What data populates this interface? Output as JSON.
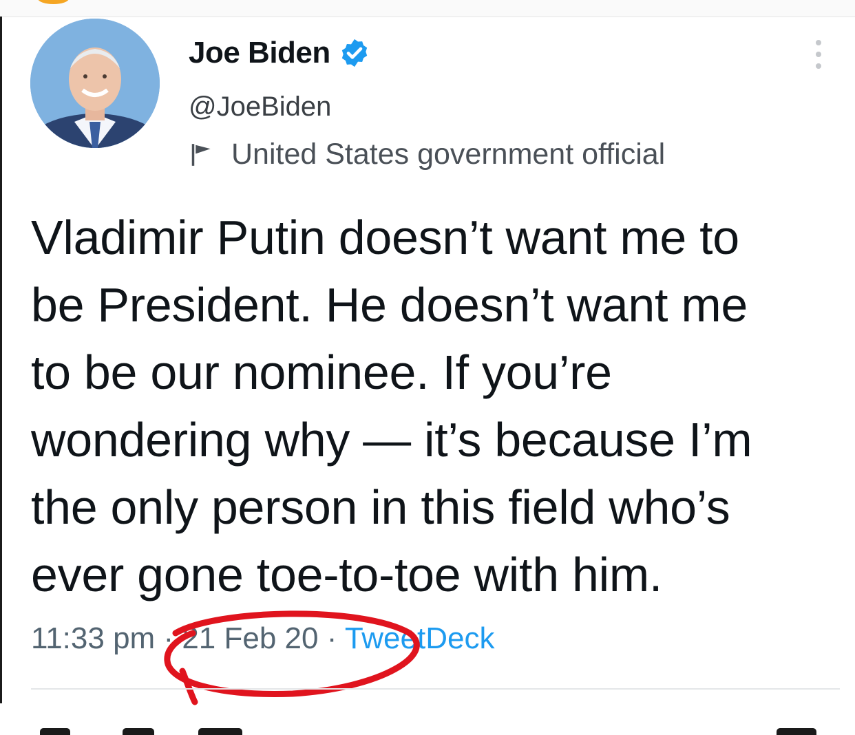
{
  "tweet": {
    "author_name": "Joe Biden",
    "handle": "@JoeBiden",
    "account_label": "United States government official",
    "text": "Vladimir Putin doesn’t want me to\nbe President. He doesn’t want me\nto be our nominee. If you’re\nwondering why — it’s because I’m\nthe only person in this field who’s\never gone toe-to-toe with him.",
    "time": "11:33 pm",
    "date": "21 Feb 20",
    "source": "TweetDeck",
    "separator": "·"
  },
  "icons": {
    "verified": "verified-badge-icon",
    "label_flag": "flag-icon",
    "more": "more-vertical-icon"
  },
  "colors": {
    "verified_blue": "#1d9bf0",
    "annotation_red": "#e0141e",
    "meta_gray": "#536471"
  }
}
